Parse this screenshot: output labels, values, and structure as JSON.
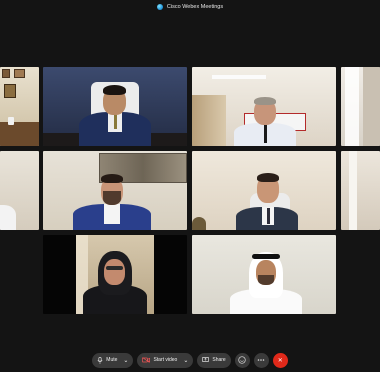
{
  "window": {
    "title": "Cisco Webex Meetings"
  },
  "controls": {
    "mute_label": "Mute",
    "start_video_label": "Start video",
    "share_label": "Share",
    "chevron": "⌄",
    "close_glyph": "✕"
  },
  "colors": {
    "leave": "#e0291a",
    "control_bg": "#3a3a3a",
    "background": "#141414"
  }
}
